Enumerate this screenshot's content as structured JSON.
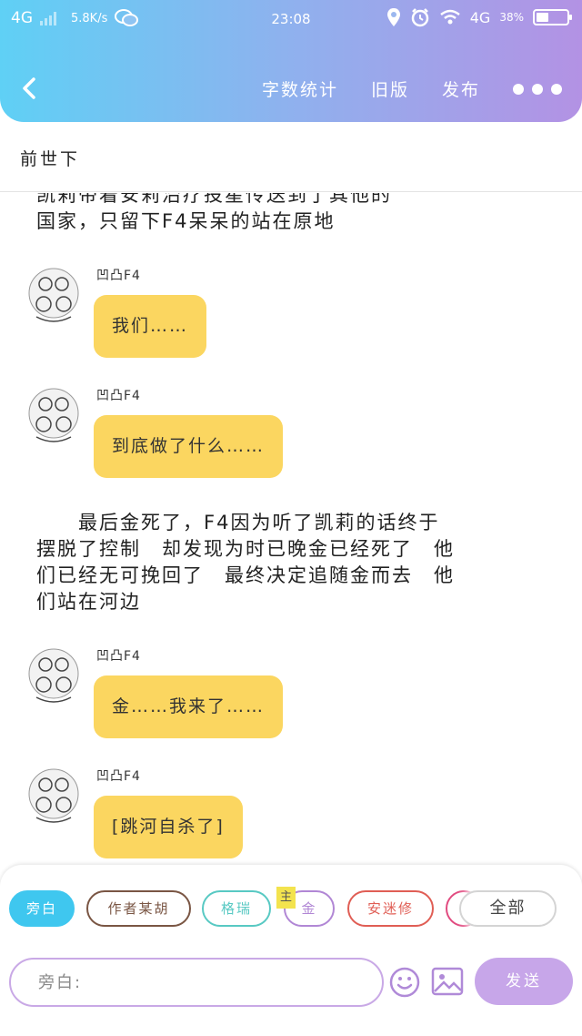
{
  "status_bar": {
    "network": "4G",
    "speed": "5.8K/s",
    "time": "23:08",
    "network_right": "4G",
    "battery": "38%"
  },
  "nav": {
    "word_count": "字数统计",
    "old_version": "旧版",
    "publish": "发布"
  },
  "chapter_title": "前世下",
  "content": {
    "narration_1_line1": "凯莉带着安莉治疗投星传送到了其他的",
    "narration_1_line2": "国家，只留下F4呆呆的站在原地",
    "messages": [
      {
        "sender": "凹凸F4",
        "text": "我们……"
      },
      {
        "sender": "凹凸F4",
        "text": "到底做了什么……"
      },
      {
        "sender": "凹凸F4",
        "text": "金……我来了……"
      },
      {
        "sender": "凹凸F4",
        "text": "[跳河自杀了]"
      }
    ],
    "narration_2": [
      "　　最后金死了，F4因为听了凯莉的话终于",
      "摆脱了控制　却发现为时已晚金已经死了　他",
      "们已经无可挽回了　最终决定追随金而去　他",
      "们站在河边"
    ]
  },
  "roles": {
    "narrator": "旁白",
    "author": "作者某胡",
    "gerui": "格瑞",
    "lead_badge": "主",
    "jin": "金",
    "anmi": "安迷修",
    "all": "全部"
  },
  "input": {
    "placeholder": "旁白:",
    "send": "发送"
  },
  "colors": {
    "bubble": "#fbd660",
    "accent_blue": "#3fc7ef",
    "accent_purple": "#c7a6e9"
  }
}
